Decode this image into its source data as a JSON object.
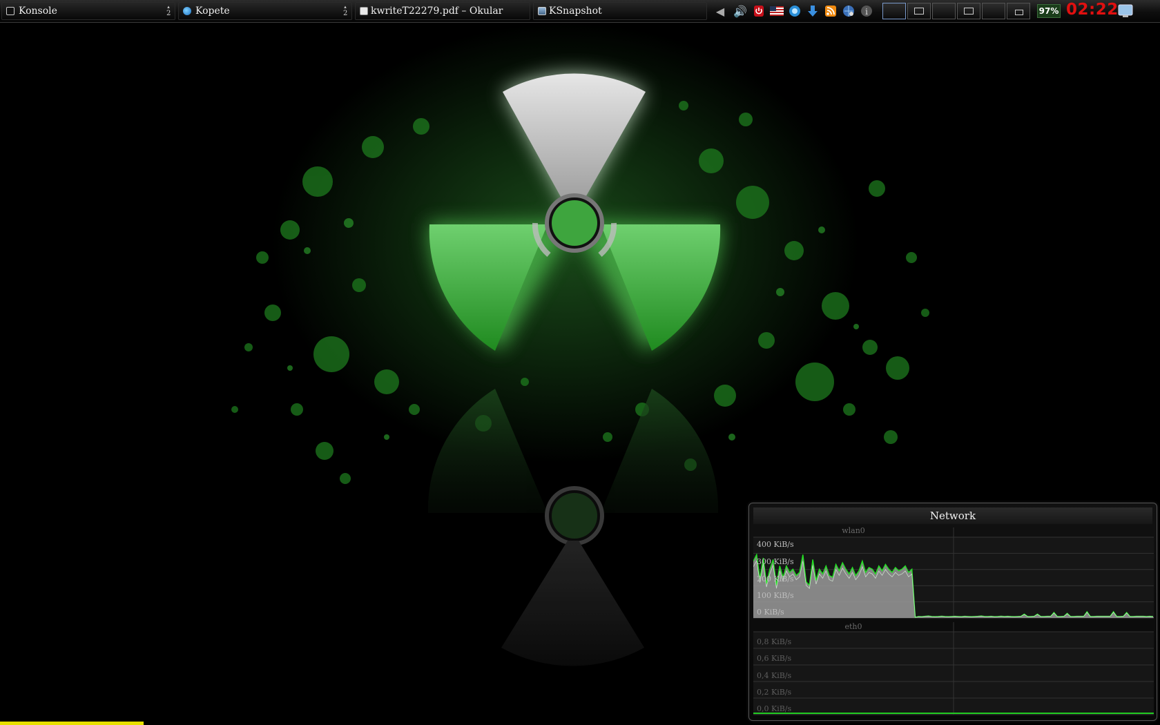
{
  "taskbar": {
    "tasks": [
      {
        "label": "Konsole",
        "icon": "terminal-icon",
        "count": "2"
      },
      {
        "label": "Kopete",
        "icon": "kopete-icon",
        "count": "2"
      },
      {
        "label": "kwriteT22279.pdf – Okular",
        "icon": "document-icon",
        "count": ""
      },
      {
        "label": "KSnapshot",
        "icon": "camera-icon",
        "count": ""
      }
    ],
    "tray_icons": [
      "arrow-left-icon",
      "volume-icon",
      "power-icon",
      "keyboard-layout-flag-icon",
      "kopete-tray-icon",
      "download-icon",
      "rss-feed-icon",
      "network-manager-icon",
      "info-icon"
    ],
    "keyboard_layout": "US",
    "pager_desktops": 6,
    "battery": "97%",
    "clock": "02:22",
    "colors": {
      "clock": "#e01010",
      "panel": "#101010"
    }
  },
  "wallpaper": {
    "theme": "radiation-symbol-green-splatter",
    "accent": "#2fa82f"
  },
  "network": {
    "title": "Network",
    "wlan": {
      "name": "wlan0",
      "ticks": [
        "300 KiB/s",
        "200 KiB/s",
        "100 KiB/s",
        "0 KiB/s"
      ],
      "top_tick": "400 KiB/s",
      "ylim": [
        0,
        400
      ]
    },
    "eth": {
      "name": "eth0",
      "ticks": [
        "0,8 KiB/s",
        "0,6 KiB/s",
        "0,4 KiB/s",
        "0,2 KiB/s",
        "0,0 KiB/s"
      ],
      "ylim": [
        0,
        1
      ]
    }
  },
  "chart_data": {
    "type": "area",
    "series": [
      {
        "name": "wlan0",
        "unit": "KiB/s",
        "values": [
          350,
          390,
          240,
          370,
          210,
          300,
          360,
          200,
          320,
          250,
          320,
          280,
          300,
          260,
          280,
          390,
          220,
          200,
          360,
          230,
          300,
          270,
          320,
          260,
          250,
          330,
          290,
          340,
          300,
          270,
          310,
          260,
          290,
          350,
          280,
          310,
          300,
          270,
          320,
          290,
          330,
          300,
          280,
          310,
          290,
          300,
          320,
          280,
          300,
          0,
          5,
          4,
          6,
          8,
          5,
          4,
          5,
          7,
          5,
          4,
          5,
          6,
          5,
          4,
          6,
          5,
          4,
          5,
          6,
          8,
          5,
          5,
          6,
          4,
          5,
          7,
          5,
          6,
          5,
          4,
          5,
          6,
          20,
          5,
          5,
          6,
          20,
          5,
          5,
          6,
          6,
          30,
          5,
          5,
          6,
          25,
          5,
          5,
          6,
          6,
          6,
          35,
          5,
          5,
          6,
          6,
          6,
          6,
          6,
          35,
          5,
          5,
          6,
          30,
          5,
          5,
          6,
          6,
          6,
          5,
          6,
          5
        ]
      },
      {
        "name": "eth0",
        "unit": "KiB/s",
        "values": [
          0,
          0,
          0,
          0,
          0,
          0,
          0,
          0,
          0,
          0
        ]
      }
    ]
  }
}
